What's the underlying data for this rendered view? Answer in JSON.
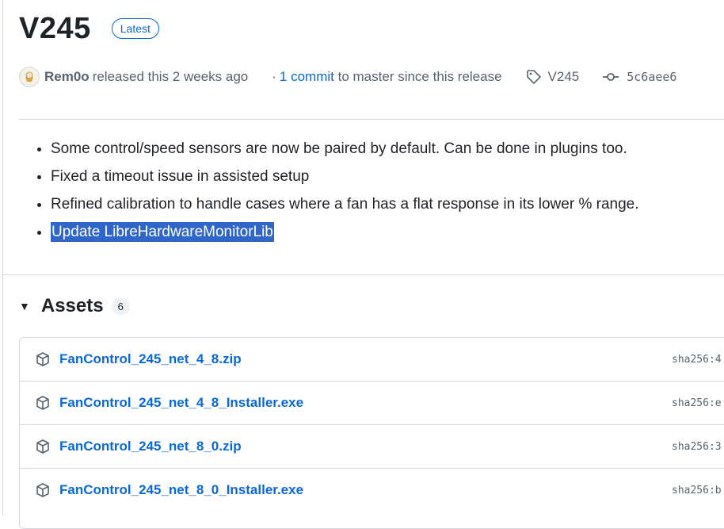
{
  "release": {
    "title": "V245",
    "badge": "Latest",
    "author": "Rem0o",
    "released_text": "released this 2 weeks ago",
    "commits_prefix": "·",
    "commits_link": "1 commit",
    "commits_suffix": "to master since this release",
    "tag": "V245",
    "commit_hash": "5c6aee6"
  },
  "notes": [
    "Some control/speed sensors are now be paired by default. Can be done in plugins too.",
    "Fixed a timeout issue in assisted setup",
    "Refined calibration to handle cases where a fan has a flat response in its lower % range.",
    "Update LibreHardwareMonitorLib"
  ],
  "assets": {
    "title": "Assets",
    "count": "6",
    "items": [
      {
        "name": "FanControl_245_net_4_8.zip",
        "sha": "sha256:4"
      },
      {
        "name": "FanControl_245_net_4_8_Installer.exe",
        "sha": "sha256:e"
      },
      {
        "name": "FanControl_245_net_8_0.zip",
        "sha": "sha256:3"
      },
      {
        "name": "FanControl_245_net_8_0_Installer.exe",
        "sha": "sha256:b"
      }
    ]
  }
}
